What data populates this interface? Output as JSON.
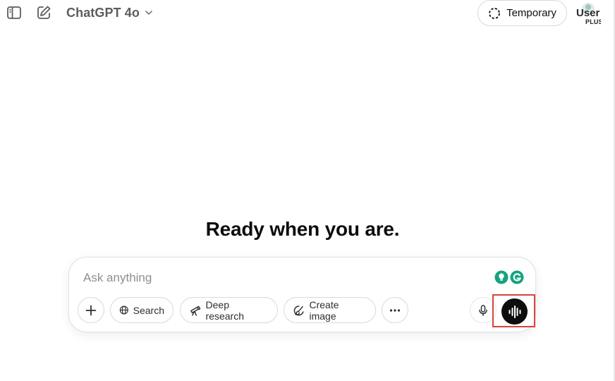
{
  "header": {
    "model_name": "ChatGPT 4o",
    "temporary_label": "Temporary",
    "user_label": "User",
    "plan_badge": "PLUS",
    "icons": [
      "sidebar-toggle-icon",
      "new-chat-icon",
      "chevron-down-icon",
      "dashed-circle-icon"
    ]
  },
  "main": {
    "headline": "Ready when you are."
  },
  "composer": {
    "placeholder": "Ask anything",
    "value": "",
    "buttons": {
      "search": "Search",
      "deep_research": "Deep research",
      "create_image": "Create image"
    },
    "icons": [
      "plus-icon",
      "globe-icon",
      "telescope-icon",
      "paint-brush-icon",
      "more-horizontal-icon",
      "microphone-icon",
      "voice-waveform-icon",
      "grammarly-icon",
      "lightbulb-extension-icon"
    ]
  },
  "colors": {
    "highlight_box": "#d9433b",
    "voice_button": "#0d0d0d",
    "extension_green": "#15a37f"
  }
}
